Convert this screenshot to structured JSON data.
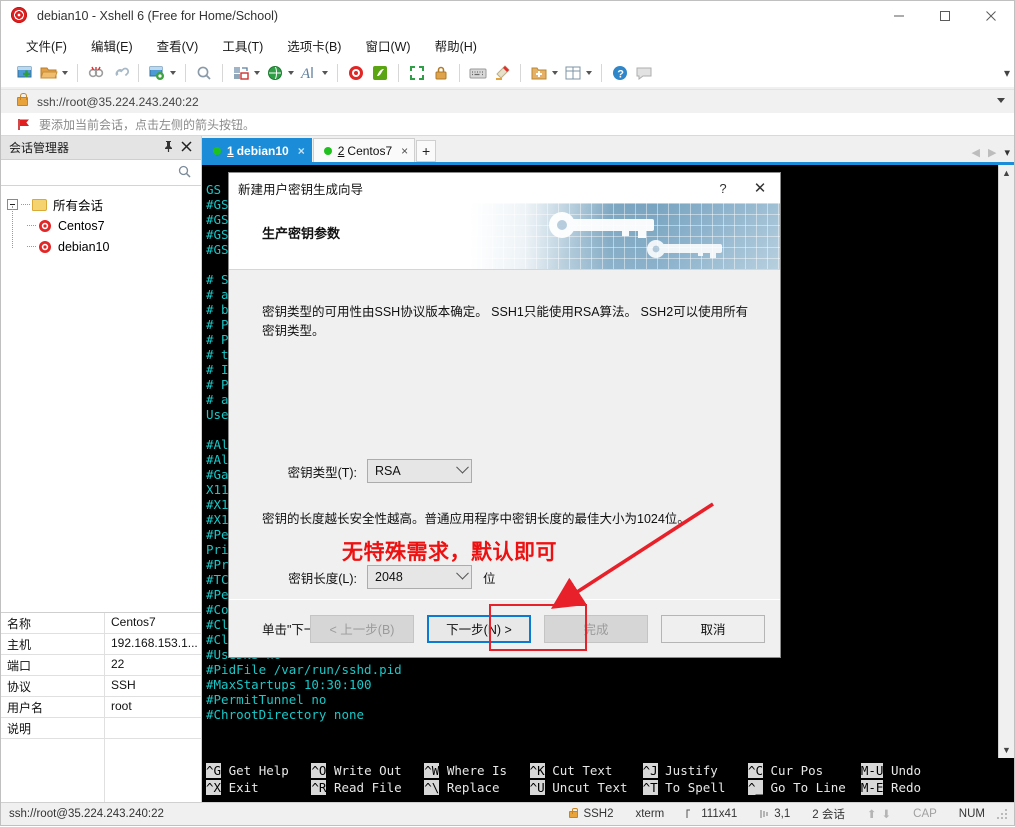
{
  "window": {
    "title": "debian10 - Xshell 6 (Free for Home/School)",
    "minimize": "–",
    "maximize": "□",
    "close": "✕"
  },
  "menubar": {
    "items": [
      {
        "label": "文件(F)",
        "name": "menu-file"
      },
      {
        "label": "编辑(E)",
        "name": "menu-edit"
      },
      {
        "label": "查看(V)",
        "name": "menu-view"
      },
      {
        "label": "工具(T)",
        "name": "menu-tools"
      },
      {
        "label": "选项卡(B)",
        "name": "menu-tab"
      },
      {
        "label": "窗口(W)",
        "name": "menu-window"
      },
      {
        "label": "帮助(H)",
        "name": "menu-help"
      }
    ]
  },
  "toolbar": {
    "icons": [
      "new-session-icon",
      "open-folder-icon",
      "disconnect-icon",
      "connect-link-icon",
      "session-properties-icon",
      "find-icon",
      "layout-icon",
      "globe-icon",
      "font-icon",
      "xshell-icon",
      "xftp-icon",
      "fullscreen-icon",
      "lock-icon",
      "keyboard-icon",
      "highlight-pen-icon",
      "add-to-folder-icon",
      "split-view-icon",
      "help-icon",
      "comment-icon"
    ],
    "overflow": "▾"
  },
  "address": {
    "icon": "lock-icon",
    "value": "ssh://root@35.224.243.240:22",
    "dropdown": "▾"
  },
  "hint": {
    "icon": "red-flag-icon",
    "text": "要添加当前会话，点击左侧的箭头按钮。"
  },
  "session_manager": {
    "title": "会话管理器",
    "pin_icon": "pin-icon",
    "close_icon": "close-icon",
    "search_placeholder": "",
    "search_value": "",
    "search_icon": "search-icon",
    "root": "所有会话",
    "sessions": [
      "Centos7",
      "debian10"
    ],
    "properties": [
      {
        "key": "名称",
        "value": "Centos7"
      },
      {
        "key": "主机",
        "value": "192.168.153.1..."
      },
      {
        "key": "端口",
        "value": "22"
      },
      {
        "key": "协议",
        "value": "SSH"
      },
      {
        "key": "用户名",
        "value": "root"
      },
      {
        "key": "说明",
        "value": ""
      }
    ]
  },
  "tabs": {
    "items": [
      {
        "num": "1",
        "label": "debian10",
        "active": true,
        "close": "×"
      },
      {
        "num": "2",
        "label": "Centos7",
        "active": false,
        "close": "×"
      }
    ],
    "add_label": "+",
    "nav_prev": "◀",
    "nav_next": "▶",
    "nav_menu": "▾"
  },
  "terminal": {
    "left_column_lines": [
      "GS",
      "#GSS",
      "#GSS",
      "#GSS",
      "#GSS",
      "",
      "# Se",
      "# an",
      "# be",
      "# Pa",
      "# PA",
      "# th",
      "# If",
      "# PA",
      "# an",
      "UseP",
      "",
      "#All",
      "#All",
      "#Gat",
      "X11F",
      "#X11",
      "#X11",
      "#Per",
      "Prin",
      "#Pri",
      "#TCP",
      "#Per",
      "#Com",
      "#Cli"
    ],
    "bottom_lines": [
      "#ClientAliveCountMax 3",
      "#UseDNS no",
      "#PidFile /var/run/sshd.pid",
      "#MaxStartups 10:30:100",
      "#PermitTunnel no",
      "#ChrootDirectory none"
    ],
    "nano_shortcuts": [
      {
        "key": "^G",
        "label": "Get Help",
        "key2": "^X",
        "label2": "Exit"
      },
      {
        "key": "^O",
        "label": "Write Out",
        "key2": "^R",
        "label2": "Read File"
      },
      {
        "key": "^W",
        "label": "Where Is",
        "key2": "^\\",
        "label2": "Replace"
      },
      {
        "key": "^K",
        "label": "Cut Text",
        "key2": "^U",
        "label2": "Uncut Text"
      },
      {
        "key": "^J",
        "label": "Justify",
        "key2": "^T",
        "label2": "To Spell"
      },
      {
        "key": "^C",
        "label": "Cur Pos",
        "key2": "^_",
        "label2": "Go To Line"
      },
      {
        "key": "M-U",
        "label": "Undo",
        "key2": "M-E",
        "label2": "Redo"
      }
    ]
  },
  "dialog": {
    "title": "新建用户密钥生成向导",
    "help_icon": "?",
    "close_icon": "✕",
    "heading": "生产密钥参数",
    "paragraph1": "密钥类型的可用性由SSH协议版本确定。 SSH1只能使用RSA算法。 SSH2可以使用所有密钥类型。",
    "key_type_label": "密钥类型(T):",
    "key_type_value": "RSA",
    "paragraph2": "密钥的长度越长安全性越高。普通应用程序中密钥长度的最佳大小为1024位。",
    "annotation_red": "无特殊需求，默认即可",
    "key_length_label": "密钥长度(L):",
    "key_length_value": "2048",
    "key_length_unit": "位",
    "paragraph3": "单击\"下一步\"生成公钥。",
    "buttons": {
      "back": "< 上一步(B)",
      "next": "下一步(N) >",
      "finish": "完成",
      "cancel": "取消"
    }
  },
  "statusbar": {
    "connection": "ssh://root@35.224.243.240:22",
    "protocol": "SSH2",
    "terminal_type": "xterm",
    "size": "111x41",
    "cursor": "3,1",
    "sessions": "2 会话",
    "up_arrow": "⬆",
    "down_arrow": "⬇",
    "cap": "CAP",
    "num": "NUM"
  },
  "colors": {
    "accent_blue": "#1a8cd8",
    "annotation_red": "#ee1111",
    "terminal_bg": "#000000",
    "terminal_fg": "#19c8c8",
    "focus_blue": "#0a7bd0"
  }
}
